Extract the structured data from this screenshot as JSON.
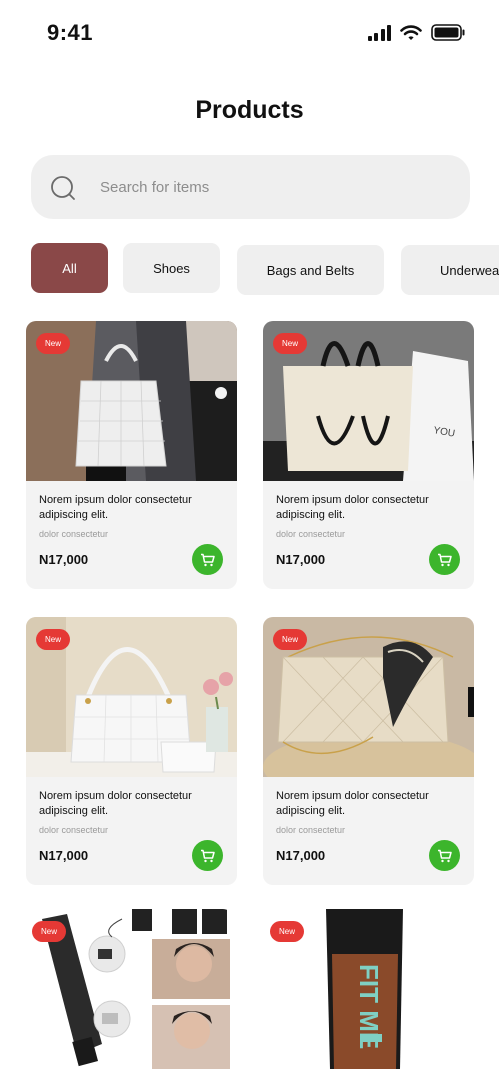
{
  "status_bar": {
    "time": "9:41",
    "icons": [
      "signal-icon",
      "wifi-icon",
      "battery-icon"
    ]
  },
  "page": {
    "title": "Products"
  },
  "search": {
    "placeholder": "Search for items",
    "value": "",
    "icon": "search-icon"
  },
  "categories": [
    {
      "label": "All",
      "active": true
    },
    {
      "label": "Shoes",
      "active": false
    },
    {
      "label": "Bags and Belts",
      "active": false
    },
    {
      "label": "Underwear",
      "active": false
    }
  ],
  "colors": {
    "accent": "#8a4848",
    "badge": "#e53935",
    "cart": "#3cb52c",
    "surface": "#efefef"
  },
  "products": [
    {
      "badge": "New",
      "image": "woman-with-white-quilted-tote",
      "title": "Norem ipsum dolor consectetur adipiscing elit.",
      "subtitle": "dolor consectetur",
      "price": "N17,000",
      "cart_icon": "cart-icon"
    },
    {
      "badge": "New",
      "image": "cream-tote-with-black-handles",
      "title": "Norem ipsum dolor consectetur adipiscing elit.",
      "subtitle": "dolor consectetur",
      "price": "N17,000",
      "cart_icon": "cart-icon"
    },
    {
      "badge": "New",
      "image": "white-quilted-shoulder-bag",
      "title": "Norem ipsum dolor consectetur adipiscing elit.",
      "subtitle": "dolor consectetur",
      "price": "N17,000",
      "cart_icon": "cart-icon"
    },
    {
      "badge": "New",
      "image": "beige-quilted-bag-with-scarf",
      "title": "Norem ipsum dolor consectetur adipiscing elit.",
      "subtitle": "dolor consectetur",
      "price": "N17,000",
      "cart_icon": "cart-icon"
    },
    {
      "badge": "New",
      "image": "hair-clipper-set",
      "title": "",
      "subtitle": "",
      "price": "",
      "cart_icon": ""
    },
    {
      "badge": "New",
      "image": "fit-me-foundation-tube",
      "title": "",
      "subtitle": "",
      "price": "",
      "cart_icon": ""
    }
  ],
  "product_image_text": {
    "bag_brand": "YOU",
    "foundation_brand": "FIT ME"
  }
}
